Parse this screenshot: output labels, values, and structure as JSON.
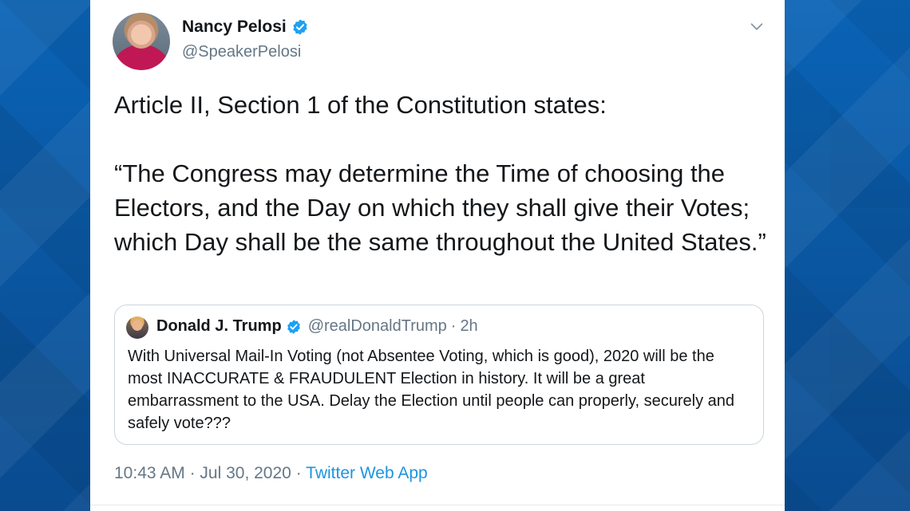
{
  "tweet": {
    "author_name": "Nancy Pelosi",
    "author_handle": "@SpeakerPelosi",
    "text_line1": "Article II, Section 1 of the Constitution states:",
    "text_quote": "“The Congress may determine the Time of choosing the Electors, and the Day on which they shall give their Votes; which Day shall be the same throughout the United States.”",
    "time": "10:43 AM",
    "date": "Jul 30, 2020",
    "separator": "·",
    "source_app": "Twitter Web App"
  },
  "quoted": {
    "author_name": "Donald J. Trump",
    "author_handle": "@realDonaldTrump",
    "separator": "·",
    "age": "2h",
    "text": "With Universal Mail-In Voting (not Absentee Voting, which is good), 2020 will be the most INACCURATE & FRAUDULENT Election in history. It will be a great embarrassment to the USA. Delay the Election until people can properly, securely and safely vote???"
  },
  "icons": {
    "verified": "verified-badge-icon",
    "menu": "chevron-down-icon"
  },
  "colors": {
    "background": "#0b5aa6",
    "verified": "#1da1f2",
    "link": "#1b95e0",
    "secondary_text": "#657786"
  }
}
